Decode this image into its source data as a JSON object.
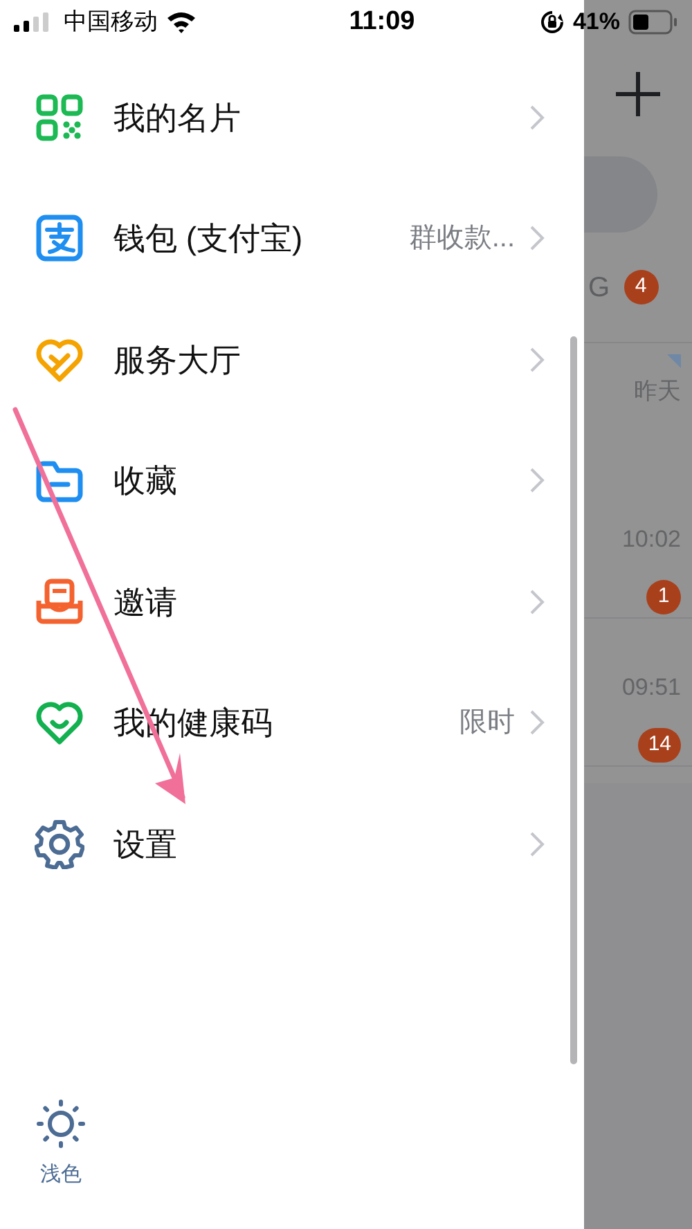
{
  "status_bar": {
    "carrier": "中国移动",
    "time": "11:09",
    "battery": "41%"
  },
  "menu": [
    {
      "label": "我的名片"
    },
    {
      "label": "钱包 (支付宝)",
      "detail": "群收款..."
    },
    {
      "label": "服务大厅"
    },
    {
      "label": "收藏"
    },
    {
      "label": "邀请"
    },
    {
      "label": "我的健康码",
      "detail": "限时"
    },
    {
      "label": "设置"
    }
  ],
  "theme_toggle": {
    "label": "浅色"
  },
  "background_chats": [
    {
      "title": "G",
      "badge": "4"
    },
    {
      "time": "昨天"
    },
    {
      "time": "10:02",
      "badge": "1"
    },
    {
      "time": "09:51",
      "badge": "14"
    }
  ]
}
